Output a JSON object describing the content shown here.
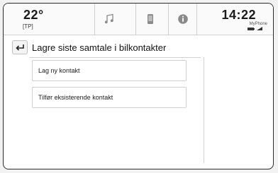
{
  "status_bar": {
    "temperature": "22°",
    "climate_mode": "[TP]",
    "time": "14:22",
    "phone_name": "MyPhone",
    "tabs": [
      {
        "icon": "music-icon"
      },
      {
        "icon": "phone-icon"
      },
      {
        "icon": "info-icon"
      }
    ]
  },
  "page": {
    "title": "Lagre siste samtale i bilkontakter"
  },
  "menu": {
    "items": [
      {
        "label": "Lag ny kontakt"
      },
      {
        "label": "Tilfør eksisterende kontakt"
      }
    ]
  }
}
